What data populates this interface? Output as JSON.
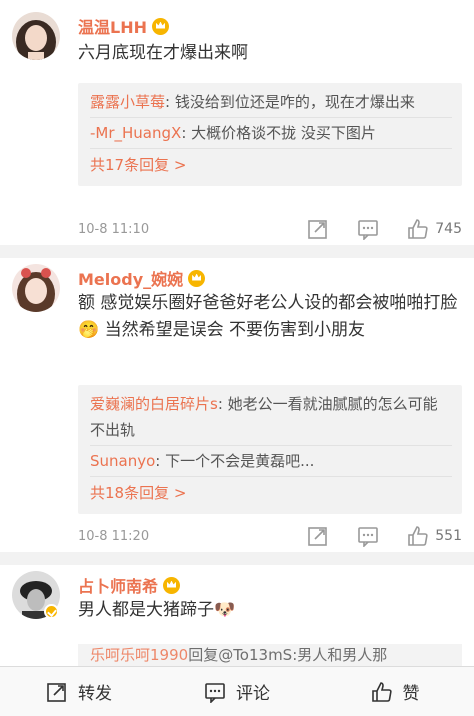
{
  "comments": [
    {
      "user": "温温LHH",
      "text": "六月底现在才爆出来啊",
      "replies": [
        {
          "name": "露露小草莓",
          "text": ": 钱没给到位还是咋的，现在才爆出来"
        },
        {
          "name": "-Mr_HuangX",
          "text": ": 大概价格谈不拢 没买下图片"
        }
      ],
      "more": "共17条回复 >",
      "time": "10-8 11:10",
      "likes": "745"
    },
    {
      "user": "Melody_婉婉",
      "text": "额 感觉娱乐圈好爸爸好老公人设的都会被啪啪打脸🤭 当然希望是误会 不要伤害到小朋友",
      "replies": [
        {
          "name": "爱巍澜的白居碎片s",
          "text": ": 她老公一看就油腻腻的怎么可能不出轨"
        },
        {
          "name": "Sunanyo",
          "text": ": 下一个不会是黄磊吧..."
        }
      ],
      "more": "共18条回复 >",
      "time": "10-8 11:20",
      "likes": "551"
    },
    {
      "user": "占卜师南希",
      "text": "男人都是大猪蹄子🐶",
      "partial_reply": {
        "name": "乐呵乐呵1990",
        "text": "回复@To13mS:男人和男人那"
      }
    }
  ],
  "bottom": {
    "repost": "转发",
    "comment": "评论",
    "like": "赞"
  },
  "colors": {
    "username": "#eb7350",
    "bg_gray": "#f2f2f2"
  }
}
